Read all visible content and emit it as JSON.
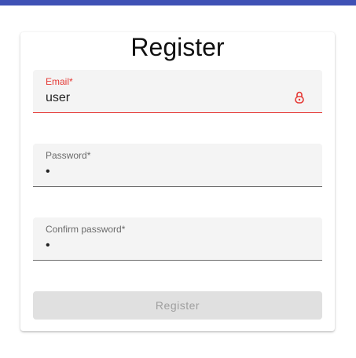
{
  "page": {
    "title": "Register"
  },
  "form": {
    "email": {
      "label": "Email*",
      "value": "user",
      "error_icon": "error-lock-icon"
    },
    "password": {
      "label": "Password*",
      "value": "•"
    },
    "confirm_password": {
      "label": "Confirm password*",
      "value": "•"
    },
    "submit_label": "Register"
  },
  "colors": {
    "app_bar": "#3f51b5",
    "error": "#e53935",
    "disabled_button_bg": "#e0e0e0",
    "disabled_button_text": "#9e9e9e"
  }
}
